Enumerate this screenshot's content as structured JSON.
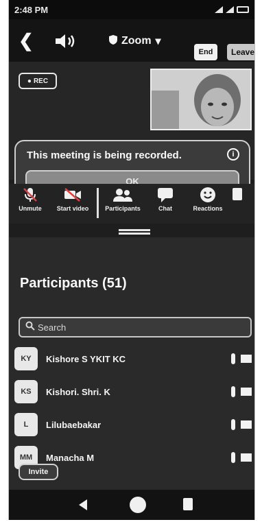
{
  "status_bar": {
    "time": "2:48 PM"
  },
  "meeting_bar": {
    "title": "Zoom",
    "end_label": "End",
    "leave_label": "Leave"
  },
  "video": {
    "rec_label": "REC"
  },
  "recording_banner": {
    "message": "This meeting is being recorded.",
    "ok_label": "OK"
  },
  "toolbar": {
    "items": [
      {
        "label": "Unmute",
        "icon": "mic-off-icon"
      },
      {
        "label": "Start video",
        "icon": "video-off-icon"
      },
      {
        "label": "Participants",
        "icon": "participants-icon"
      },
      {
        "label": "Chat",
        "icon": "chat-icon"
      },
      {
        "label": "Reactions",
        "icon": "reactions-icon"
      }
    ]
  },
  "participants": {
    "title": "Participants (51)",
    "search_placeholder": "Search",
    "list": [
      {
        "initials": "KY",
        "name": "Kishore S YKIT KC"
      },
      {
        "initials": "KS",
        "name": "Kishori. Shri. K"
      },
      {
        "initials": "L",
        "name": "Lilubaebakar"
      },
      {
        "initials": "MM",
        "name": "Manacha M"
      }
    ],
    "invite_label": "Invite"
  },
  "colors": {
    "background": "#1e1e1e",
    "banner": "#3b3b3b",
    "panel": "#2a2a2a"
  }
}
